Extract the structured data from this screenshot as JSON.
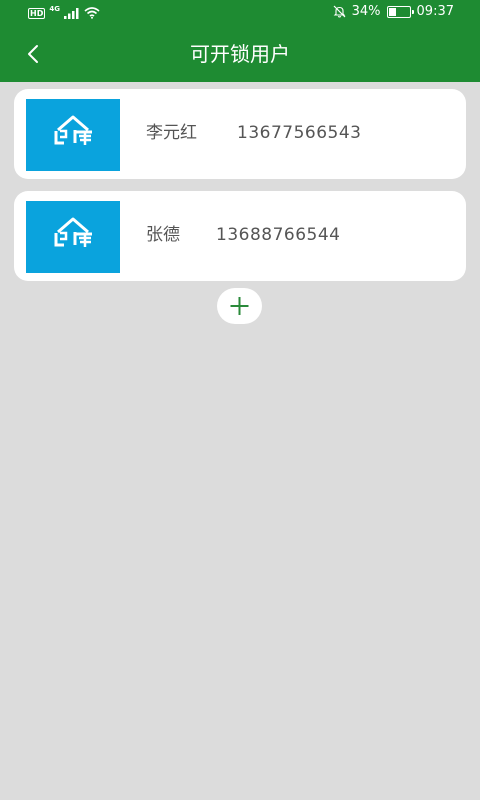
{
  "status_bar": {
    "hd": "HD",
    "network": "4G",
    "battery_percent": "34%",
    "battery_level": 0.34,
    "time": "09:37"
  },
  "nav": {
    "title": "可开锁用户",
    "back_icon": "chevron-left-icon"
  },
  "users": [
    {
      "name": "李元红",
      "phone": "13677566543",
      "logo": "feiku-logo"
    },
    {
      "name": "张德",
      "phone": "13688766544",
      "logo": "feiku-logo"
    }
  ],
  "add_icon": "plus-icon",
  "colors": {
    "primary": "#1e8b32",
    "logo_bg": "#0aa3dd",
    "background": "#dcdcdc",
    "add_icon": "#2a8a3a"
  }
}
